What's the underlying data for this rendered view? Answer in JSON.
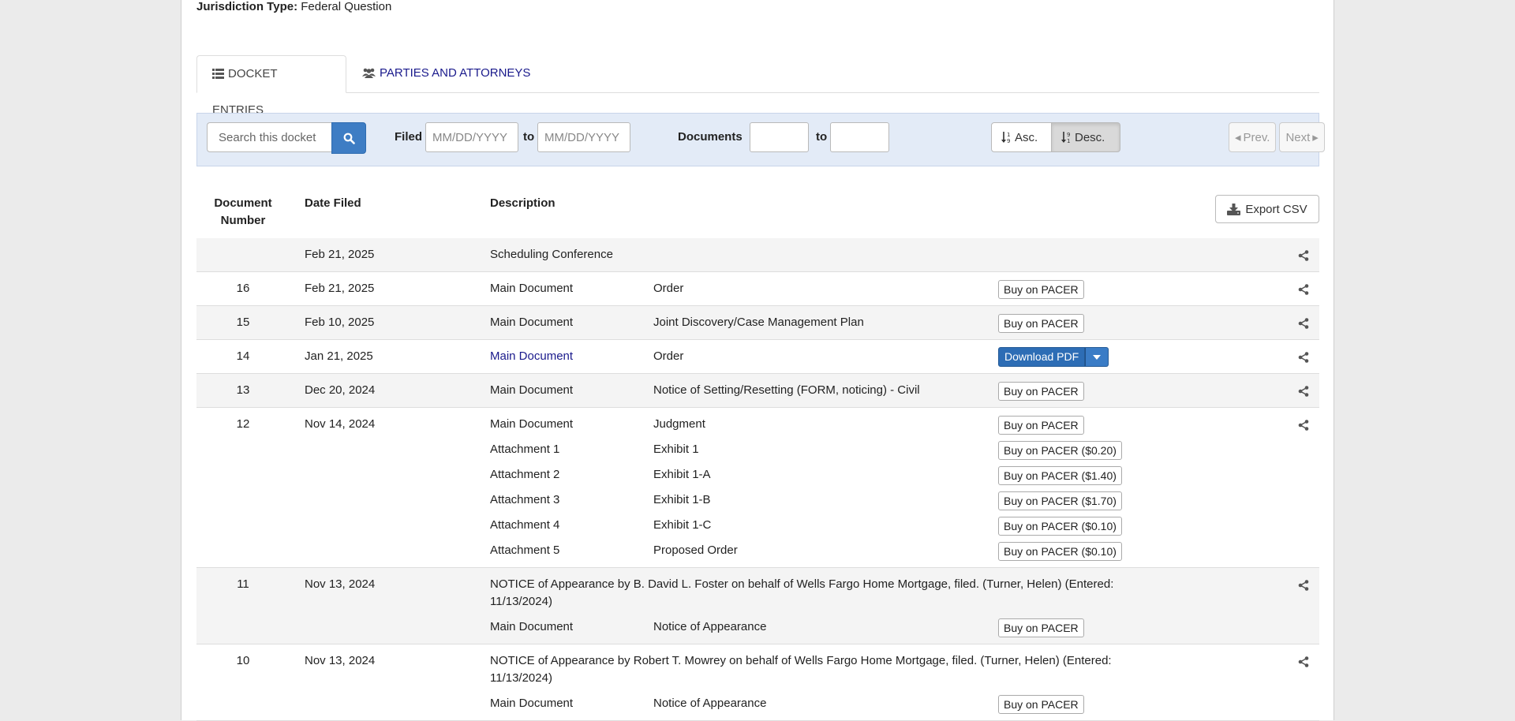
{
  "case": {
    "jurisdiction_label": "Jurisdiction Type:",
    "jurisdiction_value": "Federal Question"
  },
  "tabs": [
    {
      "label": "DOCKET ENTRIES",
      "icon": "list-icon",
      "active": true
    },
    {
      "label": "PARTIES AND ATTORNEYS",
      "icon": "users-icon",
      "active": false
    }
  ],
  "filters": {
    "search_placeholder": "Search this docket",
    "filed_label": "Filed",
    "date_from_placeholder": "MM/DD/YYYY",
    "to_label": "to",
    "date_to_placeholder": "MM/DD/YYYY",
    "documents_label": "Documents",
    "doc_to_label": "to",
    "asc_label": "Asc.",
    "desc_label": "Desc.",
    "prev_label": "Prev.",
    "next_label": "Next"
  },
  "table": {
    "col_number_line1": "Document",
    "col_number_line2": "Number",
    "col_date": "Date Filed",
    "col_desc": "Description",
    "export_label": "Export CSV"
  },
  "entries": [
    {
      "number": "",
      "date": "Feb 21, 2025",
      "desc": "Scheduling Conference"
    },
    {
      "number": "16",
      "date": "Feb 21, 2025",
      "doc": "Main Document",
      "title": "Order",
      "action": "Buy on PACER"
    },
    {
      "number": "15",
      "date": "Feb 10, 2025",
      "doc": "Main Document",
      "title": "Joint Discovery/Case Management Plan",
      "action": "Buy on PACER"
    },
    {
      "number": "14",
      "date": "Jan 21, 2025",
      "doc": "Main Document",
      "title": "Order",
      "action": "Download PDF"
    },
    {
      "number": "13",
      "date": "Dec 20, 2024",
      "doc": "Main Document",
      "title": "Notice of Setting/Resetting (FORM, noticing) - Civil",
      "action": "Buy on PACER"
    },
    {
      "number": "12",
      "date": "Nov 14, 2024",
      "docs": [
        {
          "doc": "Main Document",
          "title": "Judgment",
          "action": "Buy on PACER"
        },
        {
          "doc": "Attachment 1",
          "title": "Exhibit 1",
          "action": "Buy on PACER ($0.20)"
        },
        {
          "doc": "Attachment 2",
          "title": "Exhibit 1-A",
          "action": "Buy on PACER ($1.40)"
        },
        {
          "doc": "Attachment 3",
          "title": "Exhibit 1-B",
          "action": "Buy on PACER ($1.70)"
        },
        {
          "doc": "Attachment 4",
          "title": "Exhibit 1-C",
          "action": "Buy on PACER ($0.10)"
        },
        {
          "doc": "Attachment 5",
          "title": "Proposed Order",
          "action": "Buy on PACER ($0.10)"
        }
      ]
    },
    {
      "number": "11",
      "date": "Nov 13, 2024",
      "desc_line1": "NOTICE of Appearance by B. David L. Foster on behalf of Wells Fargo Home Mortgage, filed. (Turner, Helen) (Entered:",
      "desc_line2": "11/13/2024)",
      "doc": "Main Document",
      "title": "Notice of Appearance",
      "action": "Buy on PACER"
    },
    {
      "number": "10",
      "date": "Nov 13, 2024",
      "desc_line1": "NOTICE of Appearance by Robert T. Mowrey on behalf of Wells Fargo Home Mortgage, filed. (Turner, Helen) (Entered:",
      "desc_line2": "11/13/2024)",
      "doc": "Main Document",
      "title": "Notice of Appearance",
      "action": "Buy on PACER"
    }
  ],
  "colors": {
    "accent": "#3e7dc4",
    "link": "#1a1a8c",
    "filter_bg": "#e3ebf7"
  }
}
